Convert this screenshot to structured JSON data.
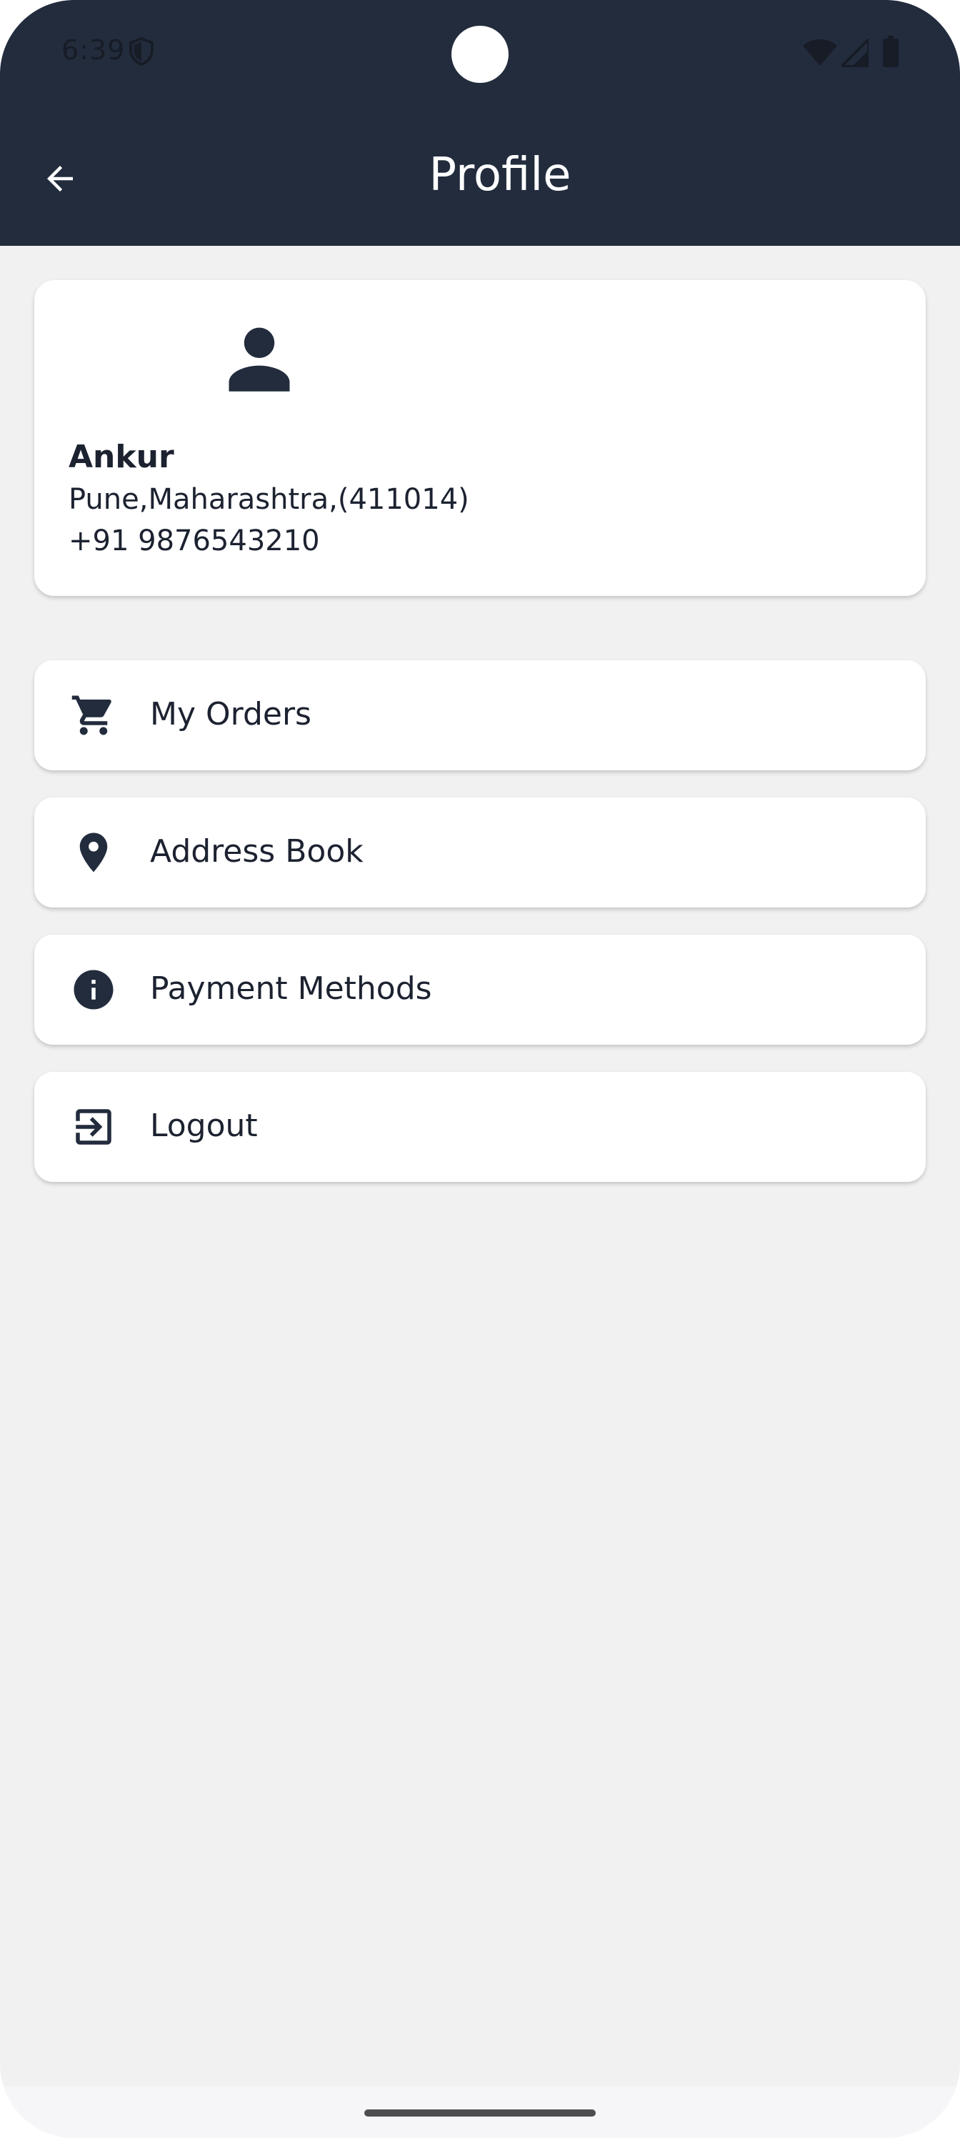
{
  "status_bar": {
    "time": "6:39",
    "icons": [
      "shield-icon",
      "wifi-icon",
      "signal-icon",
      "battery-icon"
    ]
  },
  "app_bar": {
    "title": "Profile",
    "back_icon": "arrow-back-icon"
  },
  "profile": {
    "avatar_icon": "person-icon",
    "name": "Ankur",
    "address": "Pune,Maharashtra,(411014)",
    "phone": "+91 9876543210"
  },
  "menu": {
    "items": [
      {
        "label": "My Orders",
        "icon": "cart-icon"
      },
      {
        "label": "Address Book",
        "icon": "location-pin-icon"
      },
      {
        "label": "Payment Methods",
        "icon": "info-icon"
      },
      {
        "label": "Logout",
        "icon": "logout-icon"
      }
    ]
  },
  "colors": {
    "primary_dark": "#222c3d",
    "background": "#f1f1f1",
    "card": "#ffffff",
    "text": "#1c2230"
  }
}
